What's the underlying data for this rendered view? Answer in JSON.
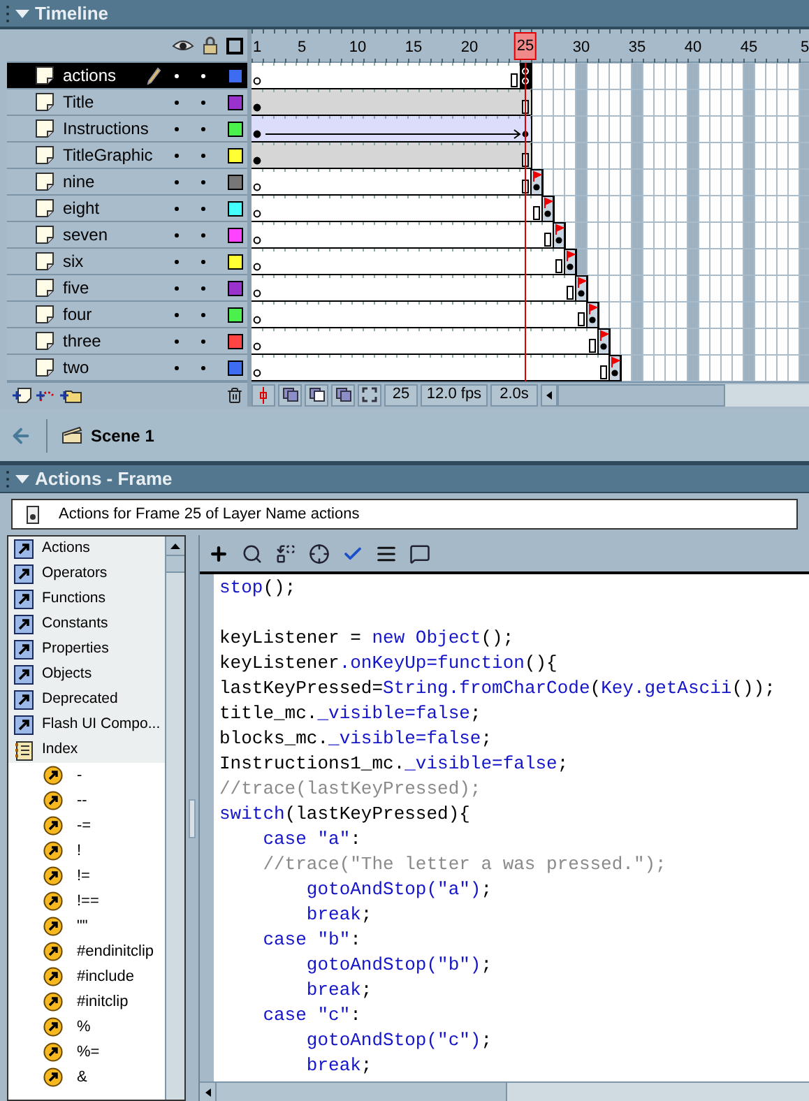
{
  "timeline": {
    "title": "Timeline",
    "ruler": [
      {
        "label": "1",
        "selected": false
      },
      {
        "label": "5",
        "selected": false
      },
      {
        "label": "10",
        "selected": false
      },
      {
        "label": "15",
        "selected": false
      },
      {
        "label": "20",
        "selected": false
      },
      {
        "label": "25",
        "selected": true
      },
      {
        "label": "30",
        "selected": false
      },
      {
        "label": "35",
        "selected": false
      },
      {
        "label": "40",
        "selected": false
      },
      {
        "label": "45",
        "selected": false
      },
      {
        "label": "5",
        "selected": false
      }
    ],
    "layers": [
      {
        "name": "actions",
        "selected": true,
        "color": "#3d6cf0",
        "kind": "empty"
      },
      {
        "name": "Title",
        "selected": false,
        "color": "#9933cc",
        "kind": "filled"
      },
      {
        "name": "Instructions",
        "selected": false,
        "color": "#4cf04c",
        "kind": "tween"
      },
      {
        "name": "TitleGraphic",
        "selected": false,
        "color": "#ffff33",
        "kind": "filled"
      },
      {
        "name": "nine",
        "selected": false,
        "color": "#777777",
        "kind": "labeled"
      },
      {
        "name": "eight",
        "selected": false,
        "color": "#44ffff",
        "kind": "labeled"
      },
      {
        "name": "seven",
        "selected": false,
        "color": "#ff44ff",
        "kind": "labeled"
      },
      {
        "name": "six",
        "selected": false,
        "color": "#ffff33",
        "kind": "labeled"
      },
      {
        "name": "five",
        "selected": false,
        "color": "#9933cc",
        "kind": "labeled"
      },
      {
        "name": "four",
        "selected": false,
        "color": "#4cf04c",
        "kind": "labeled"
      },
      {
        "name": "three",
        "selected": false,
        "color": "#ff4444",
        "kind": "labeled"
      },
      {
        "name": "two",
        "selected": false,
        "color": "#3d6cf0",
        "kind": "labeled"
      }
    ],
    "status": {
      "frame": "25",
      "rate": "12.0 fps",
      "time": "2.0s"
    }
  },
  "scene": {
    "name": "Scene 1"
  },
  "actions": {
    "title": "Actions - Frame",
    "target": "Actions for Frame 25 of Layer Name actions",
    "categories": [
      {
        "label": "Actions",
        "kind": "book"
      },
      {
        "label": "Operators",
        "kind": "book"
      },
      {
        "label": "Functions",
        "kind": "book"
      },
      {
        "label": "Constants",
        "kind": "book"
      },
      {
        "label": "Properties",
        "kind": "book"
      },
      {
        "label": "Objects",
        "kind": "book"
      },
      {
        "label": "Deprecated",
        "kind": "book"
      },
      {
        "label": "Flash UI Compo...",
        "kind": "book"
      },
      {
        "label": "Index",
        "kind": "index"
      }
    ],
    "index_items": [
      "-",
      "--",
      "-=",
      "!",
      "!=",
      "!==",
      "\"\"",
      "#endinitclip",
      "#include",
      "#initclip",
      "%",
      "%=",
      "&"
    ],
    "code": [
      {
        "kind": "code",
        "tokens": [
          {
            "kind": "kw",
            "text": "stop"
          },
          {
            "kind": "id",
            "text": "();"
          }
        ]
      },
      {
        "kind": "blank"
      },
      {
        "kind": "code",
        "tokens": [
          {
            "kind": "id",
            "text": "keyListener = "
          },
          {
            "kind": "kw",
            "text": "new Object"
          },
          {
            "kind": "id",
            "text": "();"
          }
        ]
      },
      {
        "kind": "code",
        "tokens": [
          {
            "kind": "id",
            "text": "keyListener"
          },
          {
            "kind": "kw",
            "text": ".onKeyUp=function"
          },
          {
            "kind": "id",
            "text": "(){"
          }
        ]
      },
      {
        "kind": "code",
        "tokens": [
          {
            "kind": "id",
            "text": "lastKeyPressed="
          },
          {
            "kind": "kw",
            "text": "String.fromCharCode"
          },
          {
            "kind": "id",
            "text": "("
          },
          {
            "kind": "kw",
            "text": "Key.getAscii"
          },
          {
            "kind": "id",
            "text": "());"
          }
        ]
      },
      {
        "kind": "code",
        "tokens": [
          {
            "kind": "id",
            "text": "title_mc."
          },
          {
            "kind": "kw",
            "text": "_visible=false"
          },
          {
            "kind": "id",
            "text": ";"
          }
        ]
      },
      {
        "kind": "code",
        "tokens": [
          {
            "kind": "id",
            "text": "blocks_mc."
          },
          {
            "kind": "kw",
            "text": "_visible=false"
          },
          {
            "kind": "id",
            "text": ";"
          }
        ]
      },
      {
        "kind": "code",
        "tokens": [
          {
            "kind": "id",
            "text": "Instructions1_mc."
          },
          {
            "kind": "kw",
            "text": "_visible=false"
          },
          {
            "kind": "id",
            "text": ";"
          }
        ]
      },
      {
        "kind": "code",
        "tokens": [
          {
            "kind": "cm",
            "text": "//trace(lastKeyPressed);"
          }
        ]
      },
      {
        "kind": "code",
        "tokens": [
          {
            "kind": "kw",
            "text": "switch"
          },
          {
            "kind": "id",
            "text": "(lastKeyPressed){"
          }
        ]
      },
      {
        "kind": "code",
        "tokens": [
          {
            "kind": "kw",
            "text": "    case \"a\""
          },
          {
            "kind": "id",
            "text": ":"
          }
        ]
      },
      {
        "kind": "code",
        "tokens": [
          {
            "kind": "cm",
            "text": "    //trace(\"The letter a was pressed.\");"
          }
        ]
      },
      {
        "kind": "code",
        "tokens": [
          {
            "kind": "kw",
            "text": "        gotoAndStop(\"a\")"
          },
          {
            "kind": "id",
            "text": ";"
          }
        ]
      },
      {
        "kind": "code",
        "tokens": [
          {
            "kind": "kw",
            "text": "        break"
          },
          {
            "kind": "id",
            "text": ";"
          }
        ]
      },
      {
        "kind": "code",
        "tokens": [
          {
            "kind": "kw",
            "text": "    case \"b\""
          },
          {
            "kind": "id",
            "text": ":"
          }
        ]
      },
      {
        "kind": "code",
        "tokens": [
          {
            "kind": "kw",
            "text": "        gotoAndStop(\"b\")"
          },
          {
            "kind": "id",
            "text": ";"
          }
        ]
      },
      {
        "kind": "code",
        "tokens": [
          {
            "kind": "kw",
            "text": "        break"
          },
          {
            "kind": "id",
            "text": ";"
          }
        ]
      },
      {
        "kind": "code",
        "tokens": [
          {
            "kind": "kw",
            "text": "    case \"c\""
          },
          {
            "kind": "id",
            "text": ":"
          }
        ]
      },
      {
        "kind": "code",
        "tokens": [
          {
            "kind": "kw",
            "text": "        gotoAndStop(\"c\")"
          },
          {
            "kind": "id",
            "text": ";"
          }
        ]
      },
      {
        "kind": "code",
        "tokens": [
          {
            "kind": "kw",
            "text": "        break"
          },
          {
            "kind": "id",
            "text": ";"
          }
        ]
      }
    ]
  }
}
